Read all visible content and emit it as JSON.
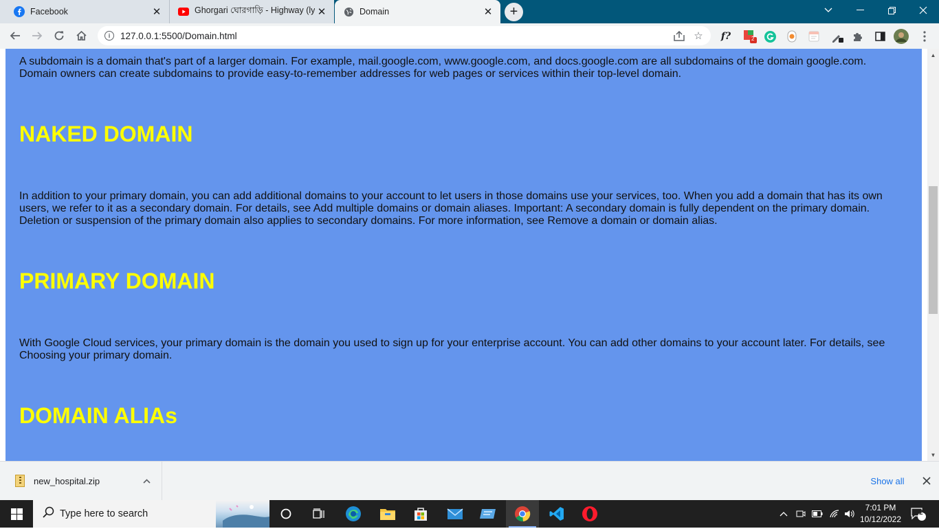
{
  "browser": {
    "tabs": [
      {
        "title": "Facebook",
        "favicon": "facebook-icon",
        "active": false
      },
      {
        "title": "Ghorgari ঘোরগাড়ি - Highway (lyr",
        "favicon": "youtube-icon",
        "active": false
      },
      {
        "title": "Domain",
        "favicon": "globe-icon",
        "active": true
      }
    ],
    "address": "127.0.0.1:5500/Domain.html",
    "tabstrip_color": "#02577a"
  },
  "page": {
    "background": "#6495ed",
    "heading_color": "#ffff00",
    "sections": [
      {
        "type": "p",
        "text": "A subdomain is a domain that's part of a larger domain. For example, mail.google.com, www.google.com, and docs.google.com are all subdomains of the domain google.com. Domain owners can create subdomains to provide easy-to-remember addresses for web pages or services within their top-level domain."
      },
      {
        "type": "h1",
        "text": "NAKED DOMAIN"
      },
      {
        "type": "p",
        "text": "In addition to your primary domain, you can add additional domains to your account to let users in those domains use your services, too. When you add a domain that has its own users, we refer to it as a secondary domain. For details, see Add multiple domains or domain aliases. Important: A secondary domain is fully dependent on the primary domain. Deletion or suspension of the primary domain also applies to secondary domains. For more information, see Remove a domain or domain alias."
      },
      {
        "type": "h1",
        "text": "PRIMARY DOMAIN"
      },
      {
        "type": "p",
        "text": "With Google Cloud services, your primary domain is the domain you used to sign up for your enterprise account. You can add other domains to your account later. For details, see Choosing your primary domain."
      },
      {
        "type": "h1",
        "text": "DOMAIN ALIAs"
      }
    ]
  },
  "downloads": {
    "file_name": "new_hospital.zip",
    "show_all_label": "Show all"
  },
  "taskbar": {
    "search_placeholder": "Type here to search",
    "time": "7:01 PM",
    "date": "10/12/2022",
    "notification_count": "2"
  },
  "extensions": {
    "badge_count": "2"
  }
}
